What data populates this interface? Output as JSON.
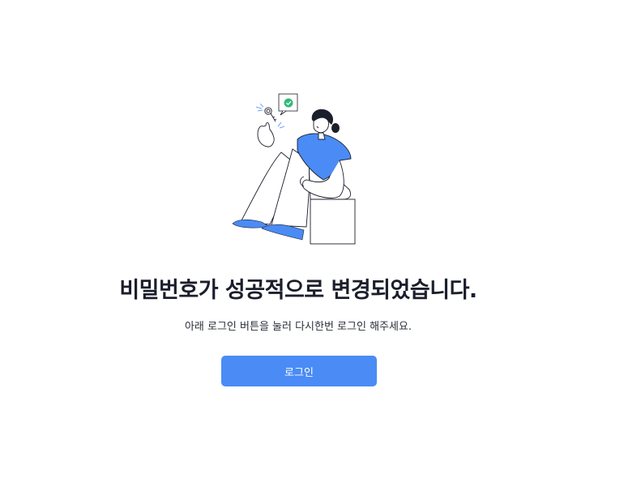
{
  "message": {
    "title": "비밀번호가 성공적으로 변경되었습니다.",
    "subtitle": "아래 로그인 버튼을 눌러 다시한번 로그인 해주세요."
  },
  "actions": {
    "login_label": "로그인"
  },
  "colors": {
    "accent": "#4a8bf5",
    "title_text": "#1b1e2b",
    "check_badge": "#35b87a"
  },
  "illustration": {
    "icon": "person-sitting-with-key-illustration"
  }
}
